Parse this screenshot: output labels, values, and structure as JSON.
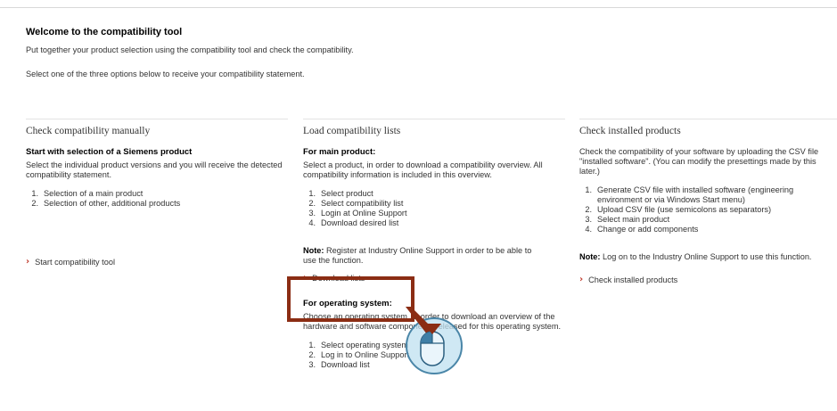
{
  "intro": {
    "title": "Welcome to the compatibility tool",
    "line1": "Put together your product selection using the compatibility tool and check the compatibility.",
    "line2": "Select one of the three options below to receive your compatibility statement."
  },
  "manual": {
    "heading": "Check compatibility manually",
    "subheading": "Start with selection of a Siemens product",
    "text": "Select the individual product versions and you will receive the detected compatibility statement.",
    "steps": [
      "Selection of a main product",
      "Selection of other, additional products"
    ],
    "link": "Start compatibility tool"
  },
  "lists": {
    "heading": "Load compatibility lists",
    "main_subheading": "For main product:",
    "main_text": "Select a product, in order to download a compatibility overview. All compatibility information is included in this overview.",
    "main_steps": [
      "Select product",
      "Select compatibility list",
      "Login at Online Support",
      "Download desired list"
    ],
    "note_label": "Note:",
    "note_text": "Register at Industry Online Support in order to be able to use the function.",
    "download_link": "Download lists",
    "os_subheading": "For operating system:",
    "os_text": "Choose an operating system, in order to download an overview of the hardware and software components released for this operating system.",
    "os_steps": [
      "Select operating system",
      "Log in to Online Support",
      "Download list"
    ]
  },
  "installed": {
    "heading": "Check installed products",
    "text": "Check the compatibility of your software by uploading the CSV file \"installed software\". (You can modify the presettings made by this later.)",
    "steps": [
      "Generate CSV file with installed software (engineering environment or via Windows Start menu)",
      "Upload CSV file (use semicolons as separators)",
      "Select main product",
      "Change or add components"
    ],
    "note_label": "Note:",
    "note_text": "Log on to the Industry Online Support to use this function.",
    "link": "Check installed products"
  },
  "colors": {
    "accent": "#c0392b",
    "highlight_frame": "#8b2d14",
    "mouse_ring": "#bfe0f0"
  },
  "icons": [
    "chevron-right-icon",
    "mouse-click-icon"
  ]
}
